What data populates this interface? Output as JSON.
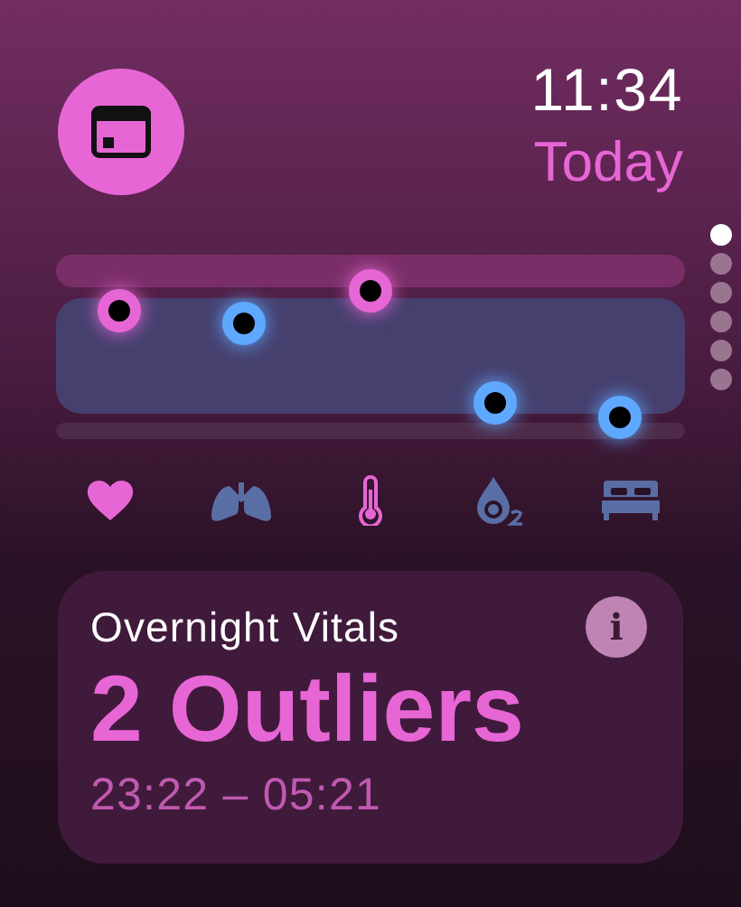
{
  "clock": {
    "time": "11:34",
    "day": "Today"
  },
  "metrics": [
    {
      "kind": "heart",
      "outlier": true
    },
    {
      "kind": "lungs",
      "outlier": false
    },
    {
      "kind": "thermometer",
      "outlier": true
    },
    {
      "kind": "oxygen",
      "outlier": false
    },
    {
      "kind": "bed",
      "outlier": false
    }
  ],
  "pages": [
    {
      "selected": true
    },
    {
      "selected": false
    },
    {
      "selected": false
    },
    {
      "selected": false
    },
    {
      "selected": false
    },
    {
      "selected": false
    }
  ],
  "card": {
    "title": "Overnight Vitals",
    "info": "i",
    "headline": "2 Outliers",
    "range": "23:22 – 05:21"
  }
}
